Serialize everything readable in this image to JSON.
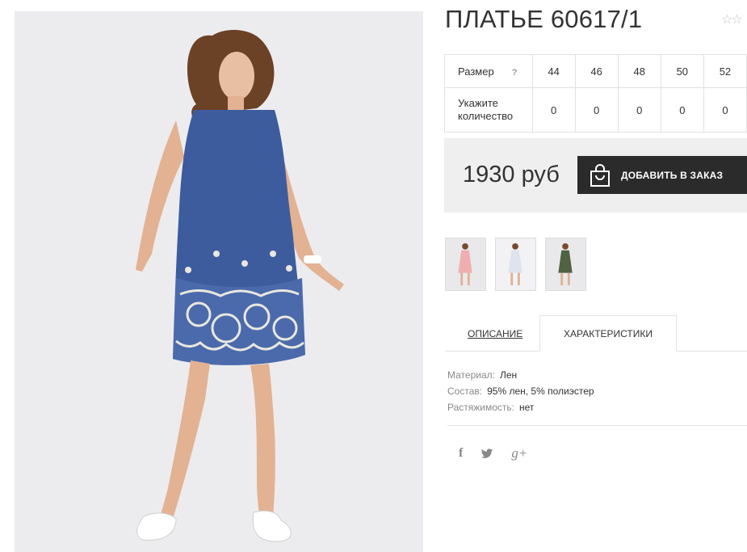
{
  "product": {
    "title": "ПЛАТЬЕ 60617/1",
    "rating_stars": "☆☆"
  },
  "sizes": {
    "label": "Размер",
    "help": "?",
    "values": [
      "44",
      "46",
      "48",
      "50",
      "52"
    ],
    "qty_label_line1": "Укажите",
    "qty_label_line2": "количество",
    "quantities": [
      "0",
      "0",
      "0",
      "0",
      "0"
    ]
  },
  "price": {
    "value": "1930 руб",
    "buy_label": "ДОБАВИТЬ В ЗАКАЗ"
  },
  "tabs": {
    "description": "ОПИСАНИЕ",
    "characteristics": "ХАРАКТЕРИСТИКИ"
  },
  "characteristics": [
    {
      "key": "Материал:",
      "value": "Лен"
    },
    {
      "key": "Состав:",
      "value": "95% лен, 5% полиэстер"
    },
    {
      "key": "Растяжимость:",
      "value": "нет"
    }
  ],
  "social": {
    "facebook": "f",
    "googleplus": "g+"
  },
  "colors": {
    "dress": "#3d5c9e",
    "button": "#2b2b2b",
    "price_bg": "#efefef"
  }
}
